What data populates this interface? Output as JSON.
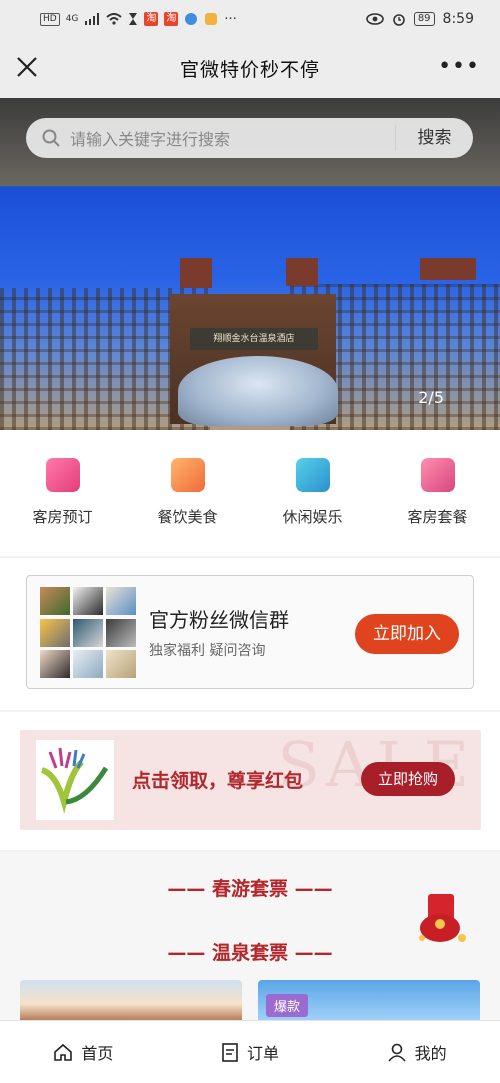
{
  "status": {
    "left_badge": "HD",
    "net": "4G",
    "app1": "淘",
    "app2": "淘",
    "time": "8:59",
    "battery": "89",
    "dots": "···"
  },
  "title": "官微特价秒不停",
  "more": "•••",
  "search": {
    "placeholder": "请输入关键字进行搜索",
    "button": "搜索"
  },
  "hero": {
    "sign": "翔顺金水台温泉酒店",
    "pager": "2/5"
  },
  "categories": [
    {
      "label": "客房预订",
      "icon": "room-icon"
    },
    {
      "label": "餐饮美食",
      "icon": "food-icon"
    },
    {
      "label": "休闲娱乐",
      "icon": "leisure-icon"
    },
    {
      "label": "客房套餐",
      "icon": "package-icon"
    }
  ],
  "fan_group": {
    "title": "官方粉丝微信群",
    "subtitle": "独家福利 疑问咨询",
    "button": "立即加入"
  },
  "coupon": {
    "text": "点击领取，尊享红包",
    "button": "立即抢购",
    "watermark": "SALE"
  },
  "tickets": {
    "section1": "—— 春游套票 ——",
    "section2": "—— 温泉套票 ——",
    "badge": "爆款"
  },
  "bottom_nav": [
    {
      "label": "首页",
      "icon": "home-icon"
    },
    {
      "label": "订单",
      "icon": "order-icon"
    },
    {
      "label": "我的",
      "icon": "user-icon"
    }
  ],
  "colors": {
    "primary_red": "#e0441f",
    "dark_red": "#a81f2a",
    "text_red": "#b3272c"
  }
}
